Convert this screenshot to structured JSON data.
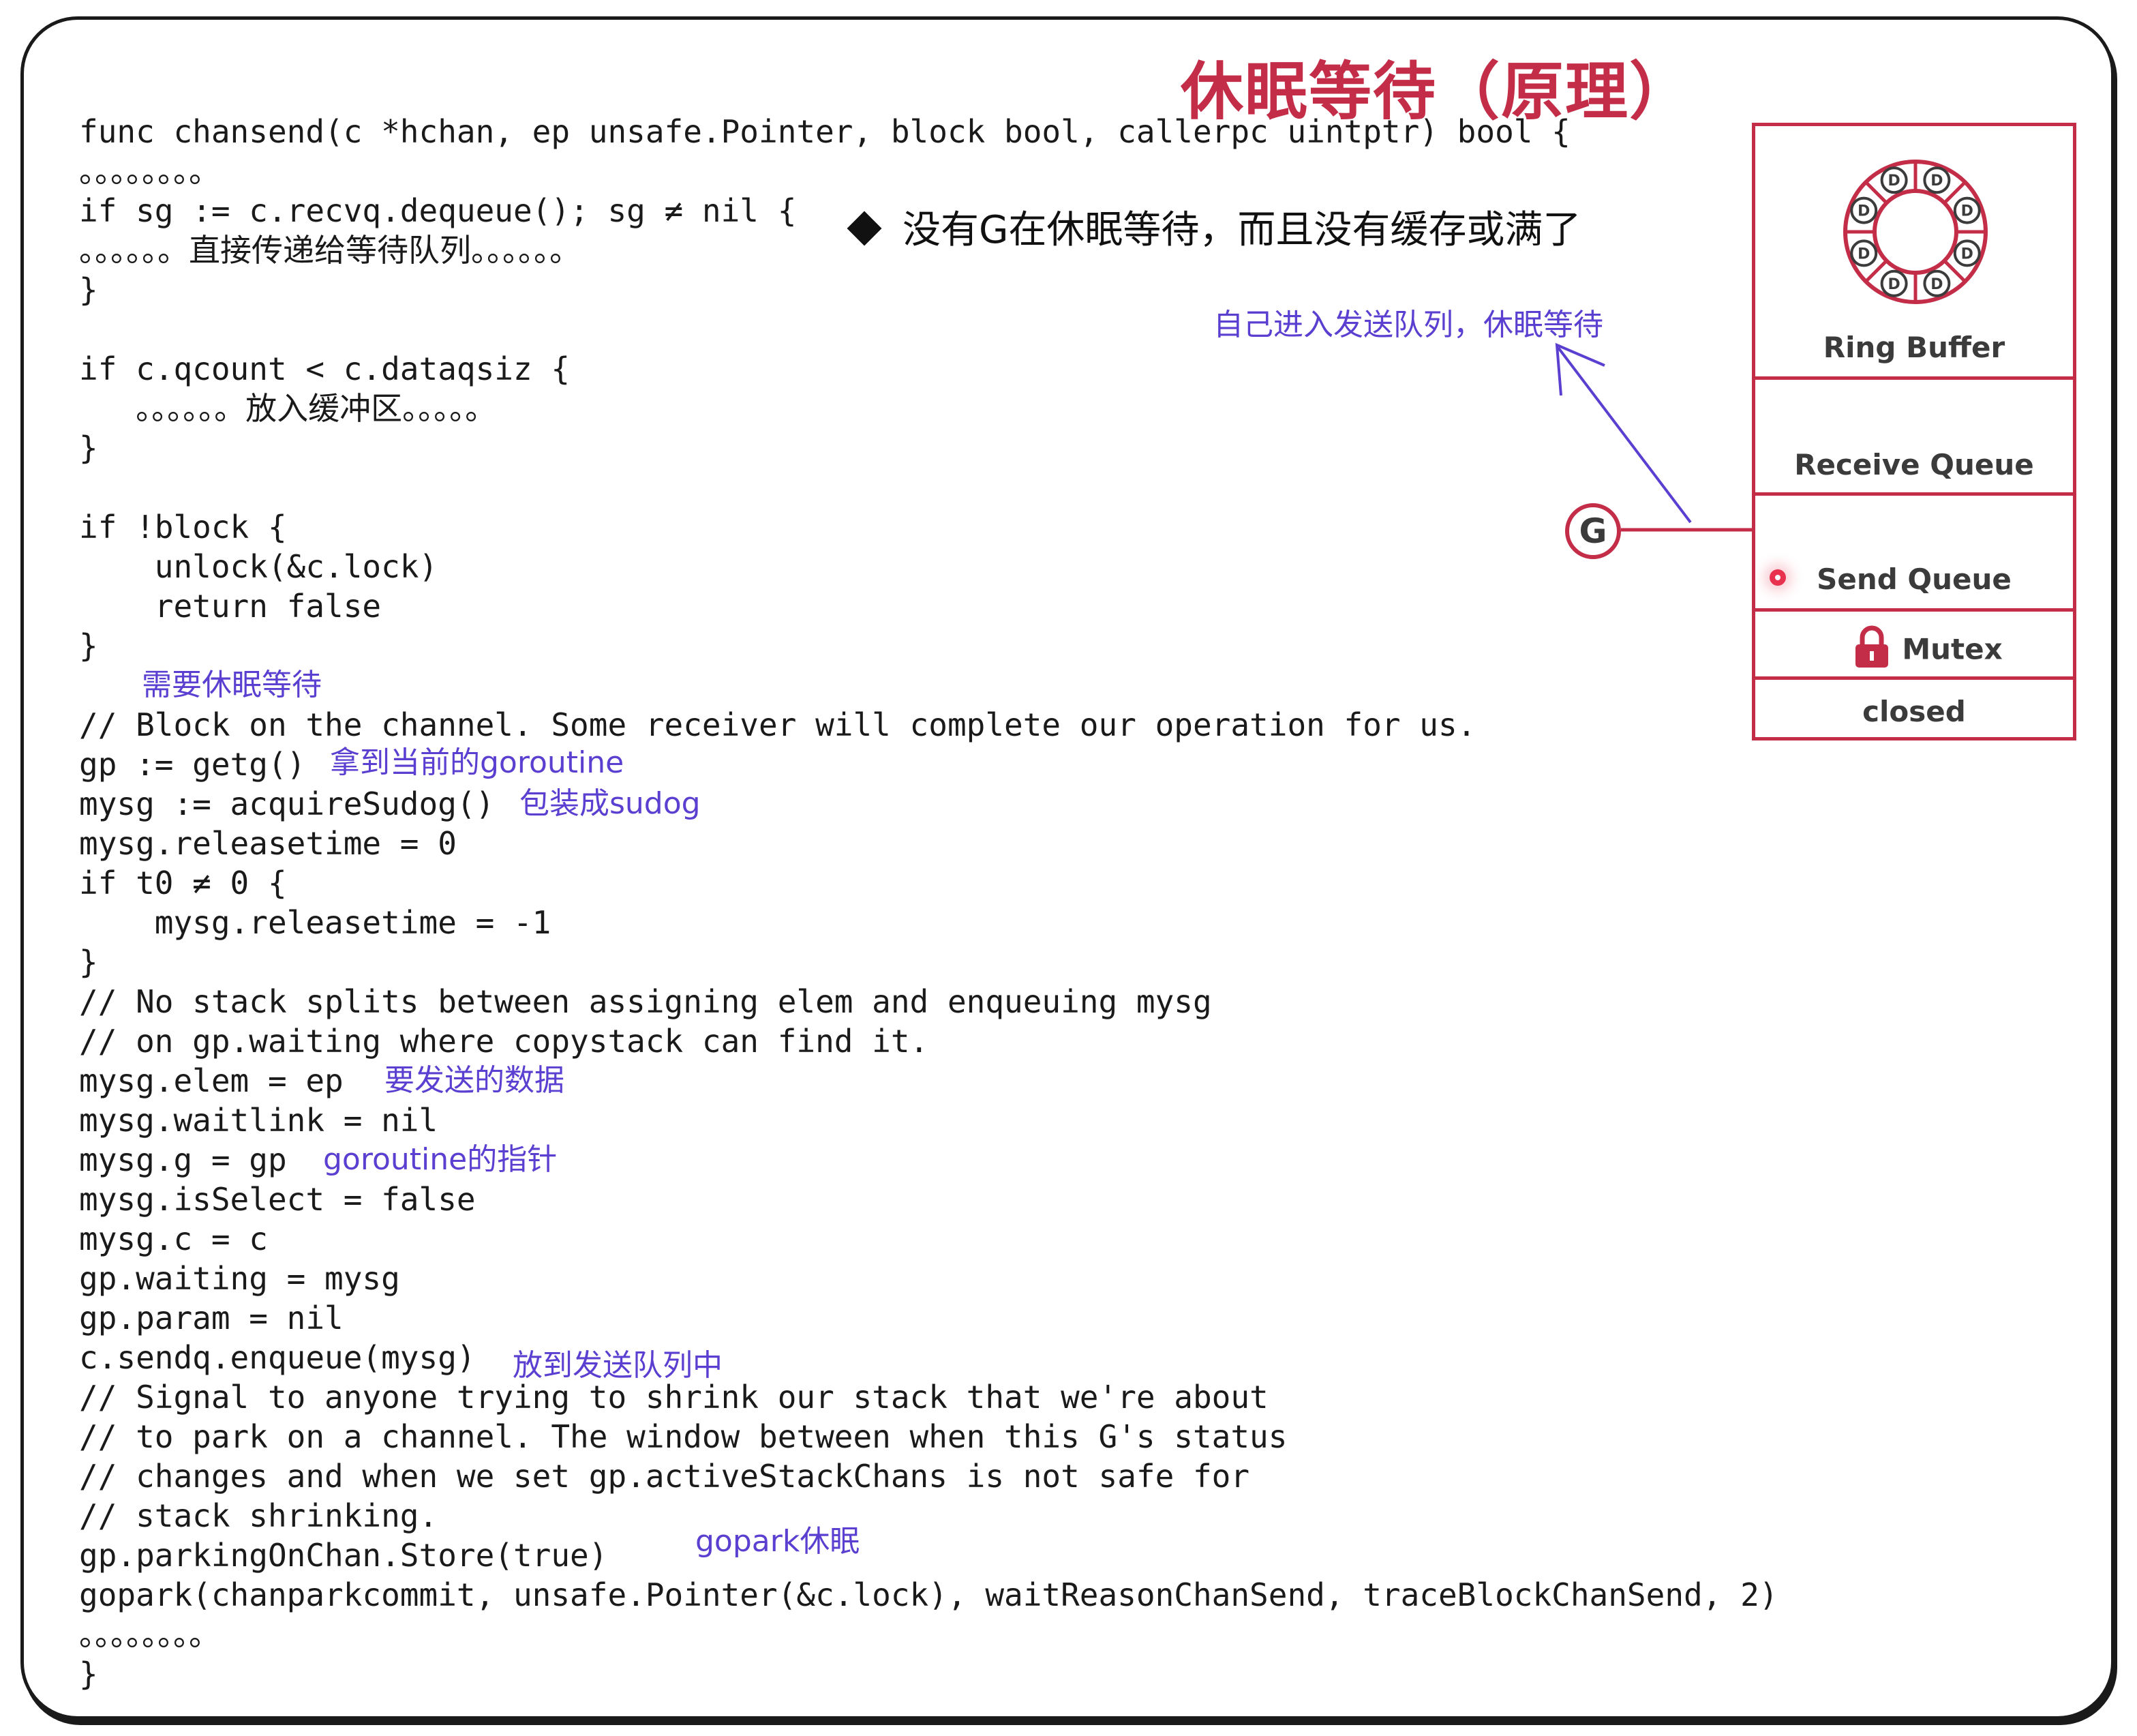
{
  "title": "休眠等待（原理）",
  "code_lines": [
    "func chansend(c *hchan, ep unsafe.Pointer, block bool, callerpc uintptr) bool {",
    "。。。。。。。。",
    "if sg := c.recvq.dequeue(); sg ≠ nil {",
    "。。。。。。直接传递给等待队列。。。。。。",
    "}",
    "",
    "if c.qcount < c.dataqsiz {",
    "   。。。。。。放入缓冲区。。。。。",
    "}",
    "",
    "if !block {",
    "    unlock(&c.lock)",
    "    return false",
    "}",
    "",
    "// Block on the channel. Some receiver will complete our operation for us.",
    "gp := getg()",
    "mysg := acquireSudog()",
    "mysg.releasetime = 0",
    "if t0 ≠ 0 {",
    "    mysg.releasetime = -1",
    "}",
    "// No stack splits between assigning elem and enqueuing mysg",
    "// on gp.waiting where copystack can find it.",
    "mysg.elem = ep",
    "mysg.waitlink = nil",
    "mysg.g = gp",
    "mysg.isSelect = false",
    "mysg.c = c",
    "gp.waiting = mysg",
    "gp.param = nil",
    "c.sendq.enqueue(mysg)",
    "// Signal to anyone trying to shrink our stack that we're about",
    "// to park on a channel. The window between when this G's status",
    "// changes and when we set gp.activeStackChans is not safe for",
    "// stack shrinking.",
    "gp.parkingOnChan.Store(true)",
    "gopark(chanparkcommit, unsafe.Pointer(&c.lock), waitReasonChanSend, traceBlockChanSend, 2)",
    "。。。。。。。。",
    "}"
  ],
  "bullet_text": "没有G在休眠等待，而且没有缓存或满了",
  "annotations": {
    "enter_send_queue": "自己进入发送队列，休眠等待",
    "need_sleep": "需要休眠等待",
    "get_goroutine": "拿到当前的goroutine",
    "wrap_sudog": "包装成sudog",
    "data_to_send": "要发送的数据",
    "goroutine_pointer": "goroutine的指针",
    "put_in_send_queue": "放到发送队列中",
    "gopark_sleep": "gopark休眠"
  },
  "hchan_panel": {
    "ring_buffer": "Ring Buffer",
    "receive_queue": "Receive Queue",
    "send_queue": "Send Queue",
    "mutex": "Mutex",
    "closed": "closed",
    "ring_slot": "D"
  },
  "g_label": "G",
  "colors": {
    "title": "#c42d48",
    "annotation": "#5a3fd0",
    "panel_border": "#c42d48",
    "code": "#1a1a1a"
  }
}
